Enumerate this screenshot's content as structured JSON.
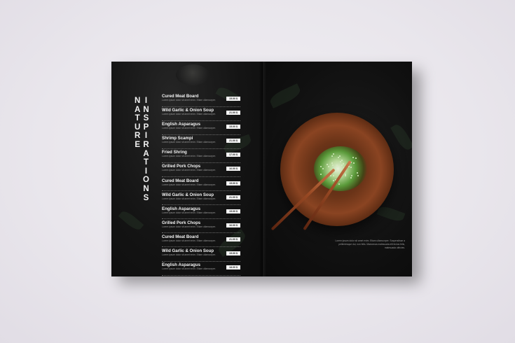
{
  "brochure": {
    "title_words": [
      "NATURE",
      "INSPIRATIONS"
    ],
    "menu_items": [
      {
        "name": "Cured Meat Board",
        "desc": "Lorem ipsum dolor sit amet enim. Etiam ullamcorper.",
        "price": "15.00 $"
      },
      {
        "name": "Wild Garlic & Onion Soup",
        "desc": "Lorem ipsum dolor sit amet enim. Etiam ullamcorper.",
        "price": "21.00 $"
      },
      {
        "name": "English Asparagus",
        "desc": "Lorem ipsum dolor sit amet enim. Etiam ullamcorper.",
        "price": "15.00 $"
      },
      {
        "name": "Shrimp Scampi",
        "desc": "Lorem ipsum dolor sit amet enim. Etiam ullamcorper.",
        "price": "21.00 $"
      },
      {
        "name": "Fried Shring",
        "desc": "Lorem ipsum dolor sit amet enim. Etiam ullamcorper.",
        "price": "17.00 $"
      },
      {
        "name": "Grilled Pork Chops",
        "desc": "Lorem ipsum dolor sit amet enim. Etiam ullamcorper.",
        "price": "16.00 $"
      },
      {
        "name": "Cured Meat Board",
        "desc": "Lorem ipsum dolor sit amet enim. Etiam ullamcorper.",
        "price": "15.00 $"
      },
      {
        "name": "Wild Garlic & Onion Soup",
        "desc": "Lorem ipsum dolor sit amet enim. Etiam ullamcorper.",
        "price": "21.00 $"
      },
      {
        "name": "English Asparagus",
        "desc": "Lorem ipsum dolor sit amet enim. Etiam ullamcorper.",
        "price": "15.00 $"
      },
      {
        "name": "Grilled Pork Chops",
        "desc": "Lorem ipsum dolor sit amet enim. Etiam ullamcorper.",
        "price": "16.00 $"
      },
      {
        "name": "Cured Meat Board",
        "desc": "Lorem ipsum dolor sit amet enim. Etiam ullamcorper.",
        "price": "21.00 $"
      },
      {
        "name": "Wild Garlic & Onion Soup",
        "desc": "Lorem ipsum dolor sit amet enim. Etiam ullamcorper.",
        "price": "15.00 $"
      },
      {
        "name": "English Asparagus",
        "desc": "Lorem ipsum dolor sit amet enim. Etiam ullamcorper.",
        "price": "18.00 $"
      }
    ],
    "caption": "Lorem ipsum dolor sit amet enim. Etiam ullamcorper. Suspendisse a pellentesque dui, non felis. Maecenas malesuada elit lectus felis, malesuada ultricies."
  }
}
